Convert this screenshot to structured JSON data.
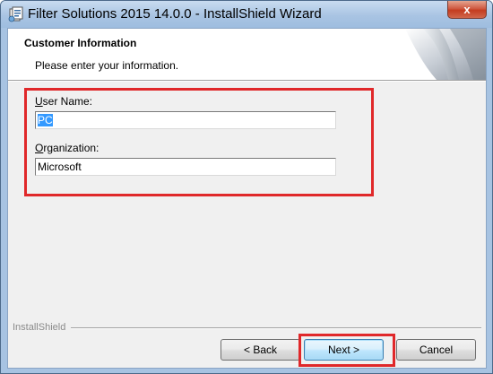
{
  "window": {
    "title": "Filter Solutions 2015 14.0.0 - InstallShield Wizard",
    "close_glyph": "x",
    "app_icon": "installer-icon"
  },
  "header": {
    "title": "Customer Information",
    "subtitle": "Please enter your information.",
    "graphic": "curled-page-graphic"
  },
  "form": {
    "user_name": {
      "label_accel": "U",
      "label_rest": "ser Name:",
      "value": "PC",
      "selected": true
    },
    "organization": {
      "label_accel": "O",
      "label_rest": "rganization:",
      "value": "Microsoft"
    }
  },
  "footer": {
    "brand": "InstallShield",
    "back_label": "< Back",
    "next_label": "Next >",
    "cancel_label": "Cancel"
  },
  "annotations": {
    "highlight_color": "#e0282a"
  },
  "colors": {
    "title_bar": "#a9c4e3",
    "close_button": "#c43c1f",
    "client_background": "#f0f0f0",
    "selection": "#3399ff"
  }
}
